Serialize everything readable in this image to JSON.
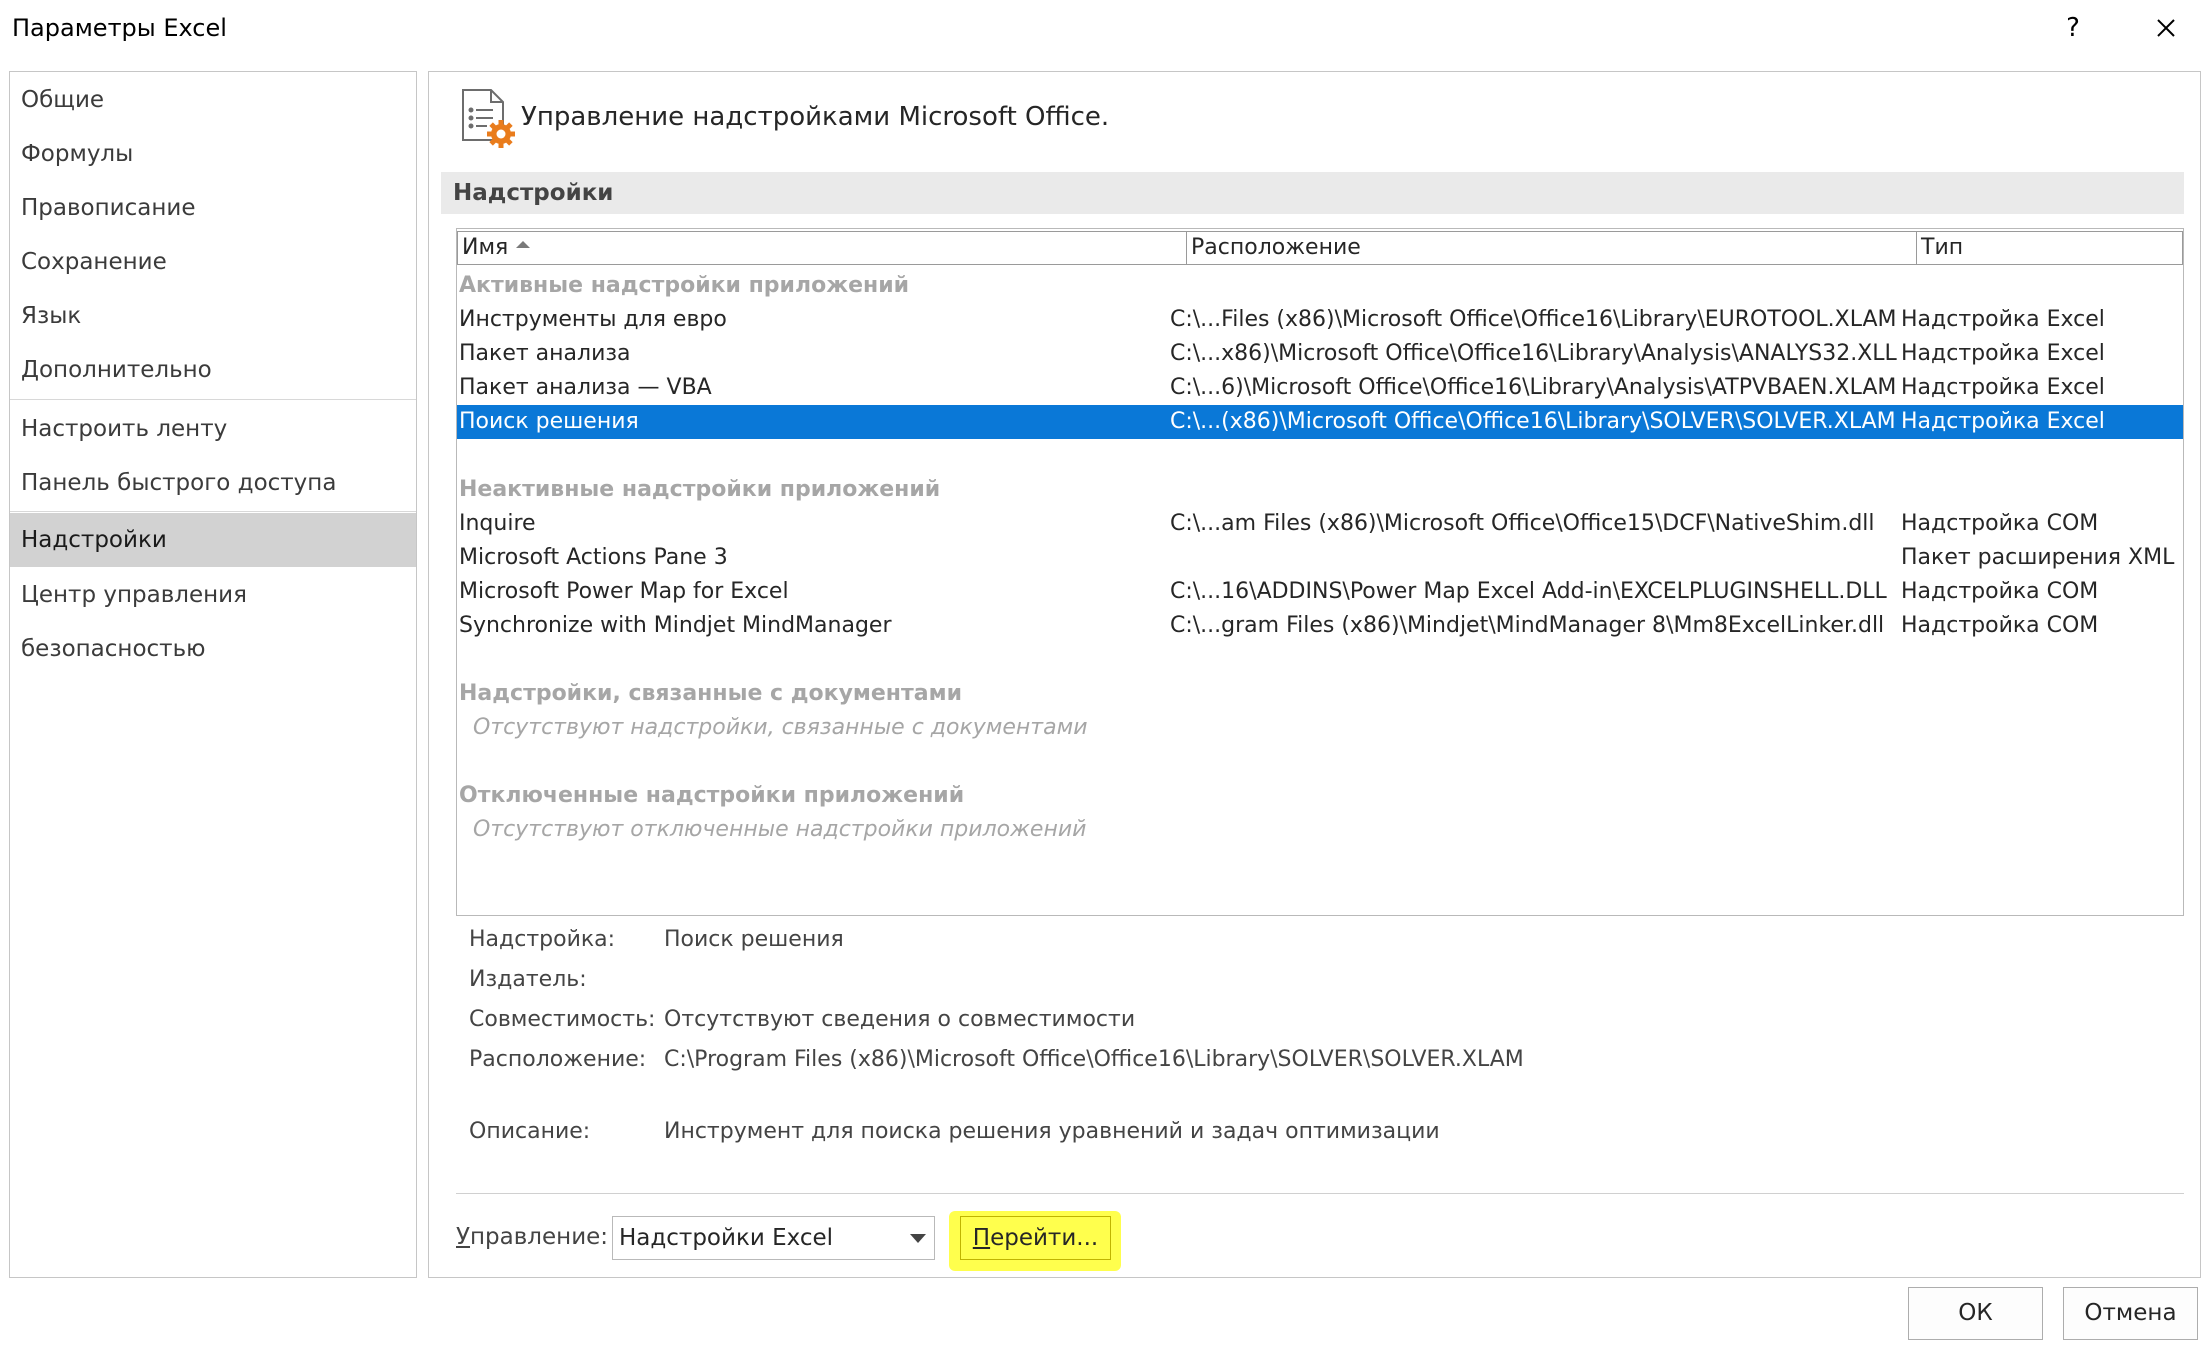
{
  "window": {
    "title": "Параметры Excel",
    "help_label": "?"
  },
  "sidebar": {
    "items": [
      {
        "label": "Общие"
      },
      {
        "label": "Формулы"
      },
      {
        "label": "Правописание"
      },
      {
        "label": "Сохранение"
      },
      {
        "label": "Язык"
      },
      {
        "label": "Дополнительно"
      },
      {
        "label": "Настроить ленту"
      },
      {
        "label": "Панель быстрого доступа"
      },
      {
        "label": "Надстройки",
        "selected": true
      },
      {
        "label": "Центр управления безопасностью"
      }
    ]
  },
  "main": {
    "header_text": "Управление надстройками Microsoft Office.",
    "section_title": "Надстройки",
    "columns": {
      "name": "Имя",
      "location": "Расположение",
      "type": "Тип"
    },
    "groups": {
      "active": "Активные надстройки приложений",
      "inactive": "Неактивные надстройки приложений",
      "document": "Надстройки, связанные с документами",
      "document_empty": "Отсутствуют надстройки, связанные с документами",
      "disabled": "Отключенные надстройки приложений",
      "disabled_empty": "Отсутствуют отключенные надстройки приложений"
    },
    "active_rows": [
      {
        "name": "Инструменты для евро",
        "location": "C:\\...Files (x86)\\Microsoft Office\\Office16\\Library\\EUROTOOL.XLAM",
        "type": "Надстройка Excel"
      },
      {
        "name": "Пакет анализа",
        "location": "C:\\...x86)\\Microsoft Office\\Office16\\Library\\Analysis\\ANALYS32.XLL",
        "type": "Надстройка Excel"
      },
      {
        "name": "Пакет анализа — VBA",
        "location": "C:\\...6)\\Microsoft Office\\Office16\\Library\\Analysis\\ATPVBAEN.XLAM",
        "type": "Надстройка Excel"
      },
      {
        "name": "Поиск решения",
        "location": "C:\\...(x86)\\Microsoft Office\\Office16\\Library\\SOLVER\\SOLVER.XLAM",
        "type": "Надстройка Excel",
        "selected": true
      }
    ],
    "inactive_rows": [
      {
        "name": "Inquire",
        "location": "C:\\...am Files (x86)\\Microsoft Office\\Office15\\DCF\\NativeShim.dll",
        "type": "Надстройка COM"
      },
      {
        "name": "Microsoft Actions Pane 3",
        "location": "",
        "type": "Пакет расширения XML"
      },
      {
        "name": "Microsoft Power Map for Excel",
        "location": "C:\\...16\\ADDINS\\Power Map Excel Add-in\\EXCELPLUGINSHELL.DLL",
        "type": "Надстройка COM"
      },
      {
        "name": "Synchronize with Mindjet MindManager",
        "location": "C:\\...gram Files (x86)\\Mindjet\\MindManager 8\\Mm8ExcelLinker.dll",
        "type": "Надстройка COM"
      }
    ],
    "details": {
      "addin_label": "Надстройка:",
      "addin_value": "Поиск решения",
      "publisher_label": "Издатель:",
      "publisher_value": "",
      "compat_label": "Совместимость:",
      "compat_value": "Отсутствуют сведения о совместимости",
      "location_label": "Расположение:",
      "location_value": "C:\\Program Files (x86)\\Microsoft Office\\Office16\\Library\\SOLVER\\SOLVER.XLAM",
      "desc_label": "Описание:",
      "desc_value": "Инструмент для поиска решения уравнений и задач оптимизации"
    },
    "manage": {
      "label_first": "У",
      "label_rest": "правление:",
      "selected": "Надстройки Excel",
      "go_first": "П",
      "go_rest": "ерейти..."
    }
  },
  "footer": {
    "ok": "ОК",
    "cancel": "Отмена"
  },
  "colors": {
    "selection": "#0a78d7",
    "highlight": "#ffff4d",
    "accent_icon": "#e97c1c"
  }
}
